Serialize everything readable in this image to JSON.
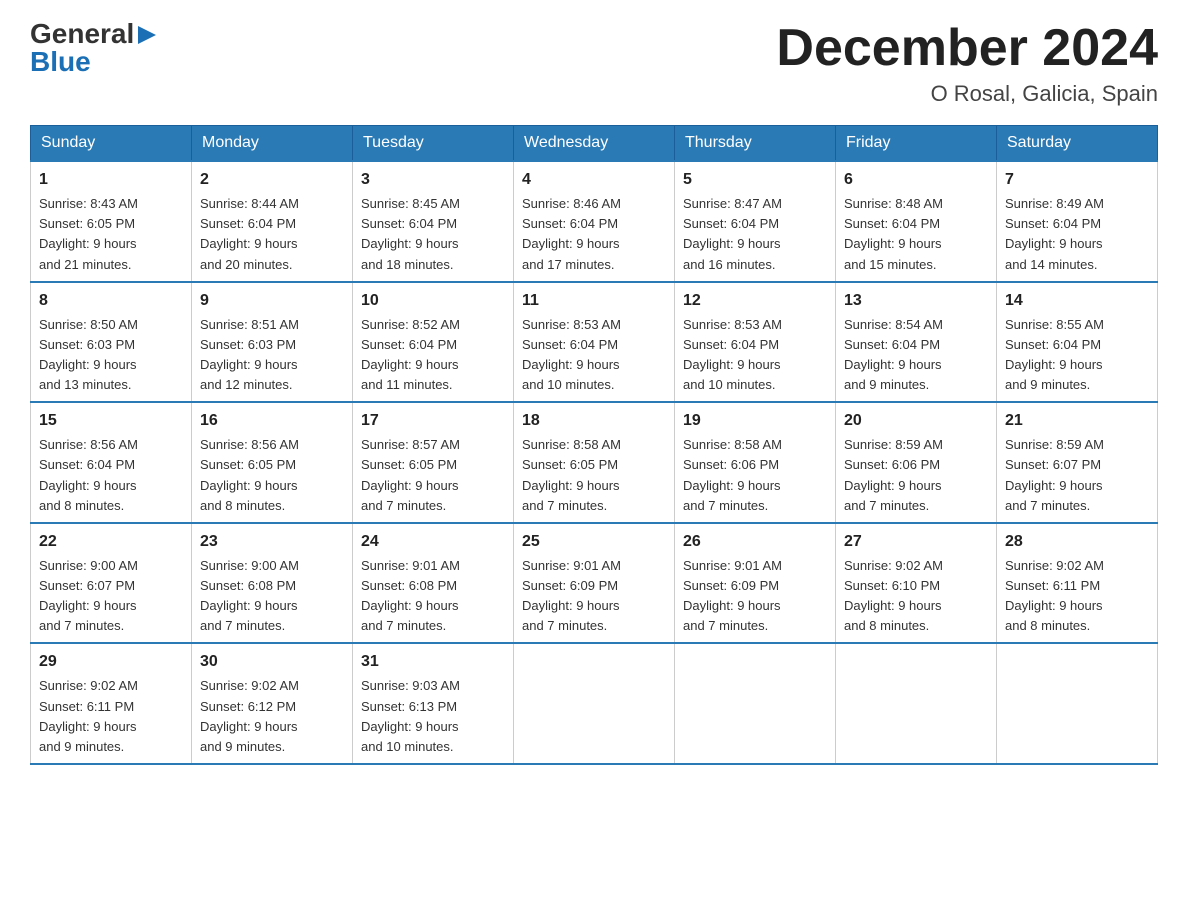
{
  "logo": {
    "general": "General",
    "blue": "Blue",
    "arrow": "▶"
  },
  "title": "December 2024",
  "location": "O Rosal, Galicia, Spain",
  "days_of_week": [
    "Sunday",
    "Monday",
    "Tuesday",
    "Wednesday",
    "Thursday",
    "Friday",
    "Saturday"
  ],
  "weeks": [
    [
      {
        "day": "1",
        "sunrise": "8:43 AM",
        "sunset": "6:05 PM",
        "daylight": "9 hours and 21 minutes."
      },
      {
        "day": "2",
        "sunrise": "8:44 AM",
        "sunset": "6:04 PM",
        "daylight": "9 hours and 20 minutes."
      },
      {
        "day": "3",
        "sunrise": "8:45 AM",
        "sunset": "6:04 PM",
        "daylight": "9 hours and 18 minutes."
      },
      {
        "day": "4",
        "sunrise": "8:46 AM",
        "sunset": "6:04 PM",
        "daylight": "9 hours and 17 minutes."
      },
      {
        "day": "5",
        "sunrise": "8:47 AM",
        "sunset": "6:04 PM",
        "daylight": "9 hours and 16 minutes."
      },
      {
        "day": "6",
        "sunrise": "8:48 AM",
        "sunset": "6:04 PM",
        "daylight": "9 hours and 15 minutes."
      },
      {
        "day": "7",
        "sunrise": "8:49 AM",
        "sunset": "6:04 PM",
        "daylight": "9 hours and 14 minutes."
      }
    ],
    [
      {
        "day": "8",
        "sunrise": "8:50 AM",
        "sunset": "6:03 PM",
        "daylight": "9 hours and 13 minutes."
      },
      {
        "day": "9",
        "sunrise": "8:51 AM",
        "sunset": "6:03 PM",
        "daylight": "9 hours and 12 minutes."
      },
      {
        "day": "10",
        "sunrise": "8:52 AM",
        "sunset": "6:04 PM",
        "daylight": "9 hours and 11 minutes."
      },
      {
        "day": "11",
        "sunrise": "8:53 AM",
        "sunset": "6:04 PM",
        "daylight": "9 hours and 10 minutes."
      },
      {
        "day": "12",
        "sunrise": "8:53 AM",
        "sunset": "6:04 PM",
        "daylight": "9 hours and 10 minutes."
      },
      {
        "day": "13",
        "sunrise": "8:54 AM",
        "sunset": "6:04 PM",
        "daylight": "9 hours and 9 minutes."
      },
      {
        "day": "14",
        "sunrise": "8:55 AM",
        "sunset": "6:04 PM",
        "daylight": "9 hours and 9 minutes."
      }
    ],
    [
      {
        "day": "15",
        "sunrise": "8:56 AM",
        "sunset": "6:04 PM",
        "daylight": "9 hours and 8 minutes."
      },
      {
        "day": "16",
        "sunrise": "8:56 AM",
        "sunset": "6:05 PM",
        "daylight": "9 hours and 8 minutes."
      },
      {
        "day": "17",
        "sunrise": "8:57 AM",
        "sunset": "6:05 PM",
        "daylight": "9 hours and 7 minutes."
      },
      {
        "day": "18",
        "sunrise": "8:58 AM",
        "sunset": "6:05 PM",
        "daylight": "9 hours and 7 minutes."
      },
      {
        "day": "19",
        "sunrise": "8:58 AM",
        "sunset": "6:06 PM",
        "daylight": "9 hours and 7 minutes."
      },
      {
        "day": "20",
        "sunrise": "8:59 AM",
        "sunset": "6:06 PM",
        "daylight": "9 hours and 7 minutes."
      },
      {
        "day": "21",
        "sunrise": "8:59 AM",
        "sunset": "6:07 PM",
        "daylight": "9 hours and 7 minutes."
      }
    ],
    [
      {
        "day": "22",
        "sunrise": "9:00 AM",
        "sunset": "6:07 PM",
        "daylight": "9 hours and 7 minutes."
      },
      {
        "day": "23",
        "sunrise": "9:00 AM",
        "sunset": "6:08 PM",
        "daylight": "9 hours and 7 minutes."
      },
      {
        "day": "24",
        "sunrise": "9:01 AM",
        "sunset": "6:08 PM",
        "daylight": "9 hours and 7 minutes."
      },
      {
        "day": "25",
        "sunrise": "9:01 AM",
        "sunset": "6:09 PM",
        "daylight": "9 hours and 7 minutes."
      },
      {
        "day": "26",
        "sunrise": "9:01 AM",
        "sunset": "6:09 PM",
        "daylight": "9 hours and 7 minutes."
      },
      {
        "day": "27",
        "sunrise": "9:02 AM",
        "sunset": "6:10 PM",
        "daylight": "9 hours and 8 minutes."
      },
      {
        "day": "28",
        "sunrise": "9:02 AM",
        "sunset": "6:11 PM",
        "daylight": "9 hours and 8 minutes."
      }
    ],
    [
      {
        "day": "29",
        "sunrise": "9:02 AM",
        "sunset": "6:11 PM",
        "daylight": "9 hours and 9 minutes."
      },
      {
        "day": "30",
        "sunrise": "9:02 AM",
        "sunset": "6:12 PM",
        "daylight": "9 hours and 9 minutes."
      },
      {
        "day": "31",
        "sunrise": "9:03 AM",
        "sunset": "6:13 PM",
        "daylight": "9 hours and 10 minutes."
      },
      null,
      null,
      null,
      null
    ]
  ],
  "labels": {
    "sunrise": "Sunrise:",
    "sunset": "Sunset:",
    "daylight": "Daylight:"
  }
}
